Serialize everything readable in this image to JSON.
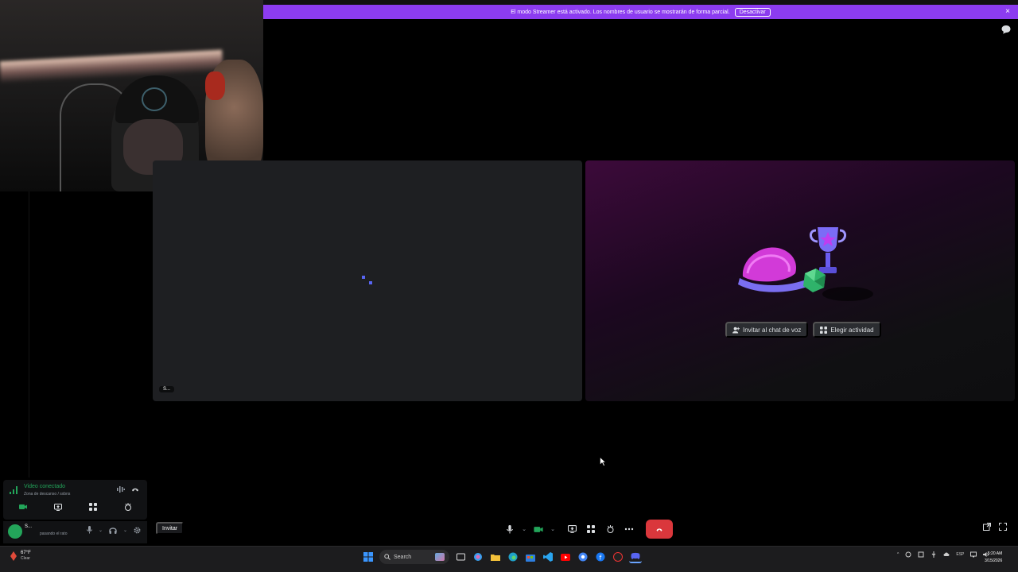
{
  "banner": {
    "message": "El modo Streamer está activado. Los nombres de usuario se mostrarán de forma parcial.",
    "button_label": "Desactivar",
    "close_glyph": "×",
    "background_color": "#8c3cf0"
  },
  "voice_panel": {
    "status": "Video conectado",
    "channel": "Zona de descanso / sxbns"
  },
  "user_panel": {
    "name": "S...",
    "status": "pasando el rato"
  },
  "tiles": {
    "left_name_tag": "S...",
    "invite_voice_label": "Invitar al chat de voz",
    "choose_activity_label": "Elegir actividad"
  },
  "controls": {
    "invite_label": "Invitar",
    "hangup_color": "#da373c",
    "icons": [
      "microphone-icon",
      "camera-icon",
      "screen-share-icon",
      "activities-icon",
      "soundboard-icon",
      "more-icon",
      "hangup-icon",
      "popout-icon",
      "fullscreen-icon"
    ]
  },
  "taskbar": {
    "weather_temp": "67°F",
    "weather_desc": "Clear",
    "search_placeholder": "Search",
    "language": "ESP",
    "time": "5:20 AM",
    "date": "3/15/2026"
  },
  "colors": {
    "accent_green": "#23a55a",
    "danger_red": "#da373c",
    "blurple": "#5865f2"
  }
}
